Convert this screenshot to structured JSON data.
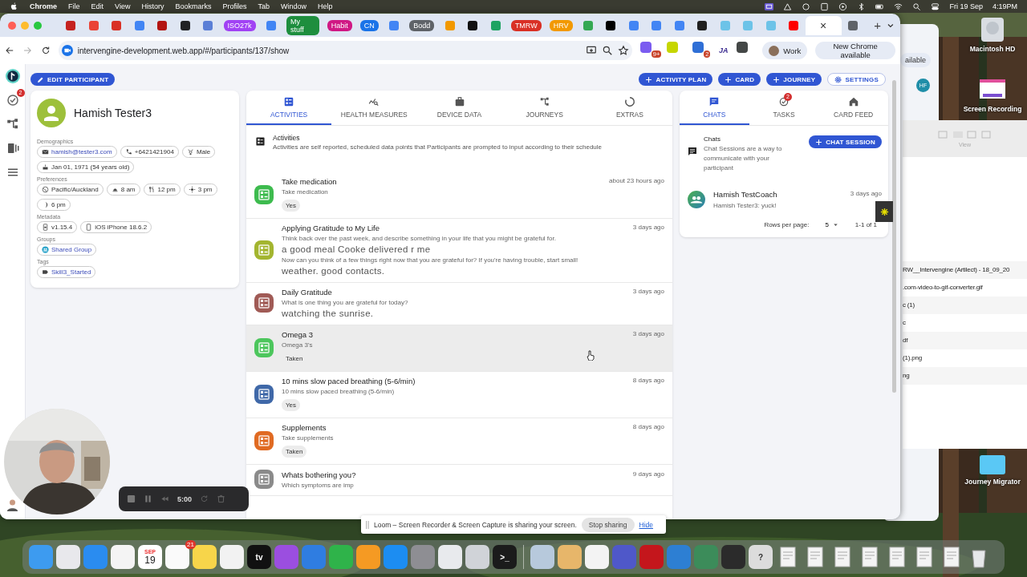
{
  "menubar": {
    "app": "Chrome",
    "menus": [
      "File",
      "Edit",
      "View",
      "History",
      "Bookmarks",
      "Profiles",
      "Tab",
      "Window",
      "Help"
    ],
    "date": "Fri 19 Sep",
    "time": "4:19PM"
  },
  "browser": {
    "tabs": [
      {
        "kind": "icon",
        "color": "#c5221f",
        "selected": false
      },
      {
        "kind": "icon",
        "color": "#ea4335",
        "selected": false
      },
      {
        "kind": "icon",
        "color": "#d93025",
        "selected": false
      },
      {
        "kind": "icon",
        "color": "#4285f4",
        "selected": false
      },
      {
        "kind": "icon",
        "color": "#b31412",
        "selected": false
      },
      {
        "kind": "icon",
        "color": "#202124",
        "selected": false
      },
      {
        "kind": "icon",
        "color": "#5b7fd6",
        "selected": false
      },
      {
        "kind": "group",
        "label": "ISO27k",
        "color": "#a142f4"
      },
      {
        "kind": "icon",
        "color": "#4285f4",
        "selected": false
      },
      {
        "kind": "group",
        "label": "My stuff",
        "color": "#1e8e3e"
      },
      {
        "kind": "group",
        "label": "Habit",
        "color": "#d01884"
      },
      {
        "kind": "group",
        "label": "CN",
        "color": "#1a73e8"
      },
      {
        "kind": "icon",
        "color": "#4285f4",
        "selected": false
      },
      {
        "kind": "group",
        "label": "Bodd",
        "color": "#5f6368"
      },
      {
        "kind": "icon",
        "color": "#f29900",
        "selected": false
      },
      {
        "kind": "icon",
        "color": "#111111",
        "selected": false
      },
      {
        "kind": "icon",
        "color": "#1ea362",
        "selected": false
      },
      {
        "kind": "group",
        "label": "TMRW",
        "color": "#d93025"
      },
      {
        "kind": "group",
        "label": "HRV",
        "color": "#f29900"
      },
      {
        "kind": "icon",
        "color": "#34a853",
        "selected": false
      },
      {
        "kind": "icon",
        "color": "#000000",
        "selected": false
      },
      {
        "kind": "icon",
        "color": "#4285f4",
        "selected": false
      },
      {
        "kind": "icon",
        "color": "#4285f4",
        "selected": false
      },
      {
        "kind": "icon",
        "color": "#4285f4",
        "selected": false
      },
      {
        "kind": "icon",
        "color": "#1f1f1f",
        "selected": false
      },
      {
        "kind": "icon",
        "color": "#6cc3e8",
        "selected": false
      },
      {
        "kind": "icon",
        "color": "#6cc3e8",
        "selected": false
      },
      {
        "kind": "icon",
        "color": "#6cc3e8",
        "selected": false
      },
      {
        "kind": "icon",
        "color": "#ff0000",
        "selected": false
      },
      {
        "kind": "page",
        "close": "×",
        "selected": true
      },
      {
        "kind": "icon",
        "color": "#5f6368",
        "selected": false
      }
    ],
    "new_tab": "+",
    "url": "intervengine-development.web.app/#/participants/137/show",
    "extensions": [
      {
        "kind": "badge",
        "color": "#7b5cf0",
        "badge": "9+"
      },
      {
        "kind": "plain",
        "color": "#c6d600"
      },
      {
        "kind": "badge",
        "color": "#2f6fd6",
        "badge": "2"
      },
      {
        "kind": "text",
        "label": "JA"
      },
      {
        "kind": "plain",
        "color": "#444746"
      }
    ],
    "profile": "Work",
    "update": "New Chrome available"
  },
  "app": {
    "rail": [
      {
        "kind": "logo"
      },
      {
        "kind": "tasks",
        "badge": "2"
      },
      {
        "kind": "journeys"
      },
      {
        "kind": "cards"
      },
      {
        "kind": "menu"
      }
    ],
    "edit_button": "EDIT PARTICIPANT",
    "actions": [
      {
        "label": "ACTIVITY PLAN",
        "kind": "add"
      },
      {
        "label": "CARD",
        "kind": "add"
      },
      {
        "label": "JOURNEY",
        "kind": "add"
      },
      {
        "label": "SETTINGS",
        "kind": "settings"
      }
    ],
    "participant": {
      "name": "Hamish Tester3",
      "sections": [
        {
          "title": "Demographics",
          "chips": [
            {
              "kind": "email",
              "text": "hamish@tester3.com",
              "link": true
            },
            {
              "kind": "phone",
              "text": "+6421421904",
              "link": false
            },
            {
              "kind": "gender",
              "text": "Male",
              "link": false
            },
            {
              "kind": "cake",
              "text": "Jan 01, 1971 (54 years old)",
              "link": false
            }
          ]
        },
        {
          "title": "Preferences",
          "chips": [
            {
              "kind": "globe",
              "text": "Pacific/Auckland",
              "link": false
            },
            {
              "kind": "sunrise",
              "text": "8 am",
              "link": false
            },
            {
              "kind": "meal",
              "text": "12 pm",
              "link": false
            },
            {
              "kind": "sun",
              "text": "3 pm",
              "link": false
            },
            {
              "kind": "moon",
              "text": "6 pm",
              "link": false
            }
          ]
        },
        {
          "title": "Metadata",
          "chips": [
            {
              "kind": "app",
              "text": "v1.15.4",
              "link": false
            },
            {
              "kind": "device",
              "text": "iOS iPhone 18.6.2",
              "link": false
            }
          ]
        },
        {
          "title": "Groups",
          "chips": [
            {
              "kind": "group",
              "text": "Shared Group",
              "link": true
            }
          ]
        },
        {
          "title": "Tags",
          "chips": [
            {
              "kind": "tag",
              "text": "Skill3_Started",
              "link": true
            }
          ]
        }
      ]
    },
    "tabs": [
      {
        "label": "ACTIVITIES",
        "kind": "activities",
        "selected": true
      },
      {
        "label": "HEALTH MEASURES",
        "kind": "health",
        "selected": false
      },
      {
        "label": "DEVICE DATA",
        "kind": "device",
        "selected": false
      },
      {
        "label": "JOURNEYS",
        "kind": "journeys",
        "selected": false
      },
      {
        "label": "EXTRAS",
        "kind": "extras",
        "selected": false
      }
    ],
    "activities_header": {
      "title": "Activities",
      "description": "Activities are self reported, scheduled data points that Participants are prompted to input according to their schedule"
    },
    "activities": [
      {
        "title": "Take medication",
        "time": "about 23 hours ago",
        "color": "#3dbb4e",
        "highlighted": false,
        "lines": [
          {
            "kind": "prompt",
            "text": "Take medication"
          },
          {
            "kind": "chip",
            "text": "Yes"
          }
        ]
      },
      {
        "title": "Applying Gratitude to My Life",
        "time": "3 days ago",
        "color": "#a3b52f",
        "highlighted": false,
        "lines": [
          {
            "kind": "prompt",
            "text": "Think back over the past week, and describe something in your life that you might be grateful for."
          },
          {
            "kind": "answer",
            "text": "a good meal Cooke delivered r me"
          },
          {
            "kind": "prompt",
            "text": "Now can you think of a few things right now that you are grateful for? If you're having trouble, start small!"
          },
          {
            "kind": "answer",
            "text": "weather. good contacts."
          }
        ]
      },
      {
        "title": "Daily Gratitude",
        "time": "3 days ago",
        "color": "#a05a55",
        "highlighted": false,
        "lines": [
          {
            "kind": "prompt",
            "text": "What is one thing you are grateful for today?"
          },
          {
            "kind": "answer",
            "text": "watching the sunrise."
          }
        ]
      },
      {
        "title": "Omega 3",
        "time": "3 days ago",
        "color": "#4cc65c",
        "highlighted": true,
        "lines": [
          {
            "kind": "prompt",
            "text": "Omega 3's"
          },
          {
            "kind": "chip",
            "text": "Taken"
          }
        ]
      },
      {
        "title": "10 mins slow paced breathing (5-6/min)",
        "time": "8 days ago",
        "color": "#3f68a8",
        "highlighted": false,
        "lines": [
          {
            "kind": "prompt",
            "text": "10 mins slow paced breathing (5-6/min)"
          },
          {
            "kind": "chip",
            "text": "Yes"
          }
        ]
      },
      {
        "title": "Supplements",
        "time": "8 days ago",
        "color": "#e06a22",
        "highlighted": false,
        "lines": [
          {
            "kind": "prompt",
            "text": "Take supplements"
          },
          {
            "kind": "chip",
            "text": "Taken"
          }
        ]
      },
      {
        "title": "Whats bothering you?",
        "time": "9 days ago",
        "color": "#8a8a8a",
        "highlighted": false,
        "lines": [
          {
            "kind": "prompt",
            "text": "Which symptoms are imp"
          }
        ]
      }
    ],
    "side_tabs": [
      {
        "label": "CHATS",
        "kind": "chat",
        "selected": true
      },
      {
        "label": "TASKS",
        "kind": "tasks",
        "badge": "2",
        "selected": false
      },
      {
        "label": "CARD FEED",
        "kind": "home",
        "selected": false
      }
    ],
    "chats_header": {
      "title": "Chats",
      "description": "Chat Sessions are a way to communicate with your participant",
      "button": "CHAT SESSION"
    },
    "chats": [
      {
        "name": "Hamish TestCoach",
        "message": "Hamish Tester3: yuck!",
        "time": "3 days ago"
      }
    ],
    "pagination": {
      "label": "Rows per page:",
      "rows": "5",
      "range": "1-1 of 1"
    }
  },
  "back_windows": {
    "update": "ailable",
    "avatar": "HF",
    "view": "View",
    "files": [
      "RW__Intervengine (Artilect) - 18_09_20",
      ".com-video-to-gif-converter.gif",
      "c (1)",
      "c",
      "df",
      "(1).png",
      "ng"
    ]
  },
  "desktop_icons": [
    {
      "kind": "disk",
      "label": "Macintosh HD"
    },
    {
      "kind": "thumbnail",
      "label": "Screen Recording"
    },
    {
      "kind": "folder",
      "label": "Journey Migrator"
    }
  ],
  "loom": {
    "timer": "5:00",
    "sharing": "Loom – Screen Recorder & Screen Capture is sharing your screen.",
    "stop": "Stop sharing",
    "hide": "Hide"
  },
  "dock": [
    {
      "kind": "app",
      "color": "#3d9bf0"
    },
    {
      "kind": "app",
      "color": "#e8e8ec"
    },
    {
      "kind": "app",
      "color": "#2a8cf0"
    },
    {
      "kind": "app",
      "color": "#f4f4f4"
    },
    {
      "kind": "calendar",
      "month": "SEP",
      "day": "19"
    },
    {
      "kind": "app",
      "color": "#fafafa",
      "badge": "21"
    },
    {
      "kind": "app",
      "color": "#f7d54a"
    },
    {
      "kind": "app",
      "color": "#f2f2f2"
    },
    {
      "kind": "app",
      "color": "#111111",
      "glyph": "tv"
    },
    {
      "kind": "app",
      "color": "#9b4ee0"
    },
    {
      "kind": "app",
      "color": "#2f7de1"
    },
    {
      "kind": "app",
      "color": "#2fb34a"
    },
    {
      "kind": "app",
      "color": "#f59a23"
    },
    {
      "kind": "app",
      "color": "#1c8df2"
    },
    {
      "kind": "app",
      "color": "#8e8e93"
    },
    {
      "kind": "app",
      "color": "#e8eaed"
    },
    {
      "kind": "app",
      "color": "#d0d3d8"
    },
    {
      "kind": "app",
      "color": "#1b1b1b",
      "glyph": ">_"
    },
    {
      "kind": "separator"
    },
    {
      "kind": "app",
      "color": "#b7c9dc"
    },
    {
      "kind": "app",
      "color": "#e7b66a"
    },
    {
      "kind": "app",
      "color": "#f3f3f3"
    },
    {
      "kind": "app",
      "color": "#4f58c9"
    },
    {
      "kind": "app",
      "color": "#c4161c"
    },
    {
      "kind": "app",
      "color": "#2d7fd3"
    },
    {
      "kind": "app",
      "color": "#3c8c5a"
    },
    {
      "kind": "app",
      "color": "#2b2b2b"
    },
    {
      "kind": "app",
      "color": "#dcdcdc",
      "glyph": "?"
    },
    {
      "kind": "doc"
    },
    {
      "kind": "doc"
    },
    {
      "kind": "doc"
    },
    {
      "kind": "doc"
    },
    {
      "kind": "doc"
    },
    {
      "kind": "doc"
    },
    {
      "kind": "doc"
    },
    {
      "kind": "trash"
    }
  ]
}
